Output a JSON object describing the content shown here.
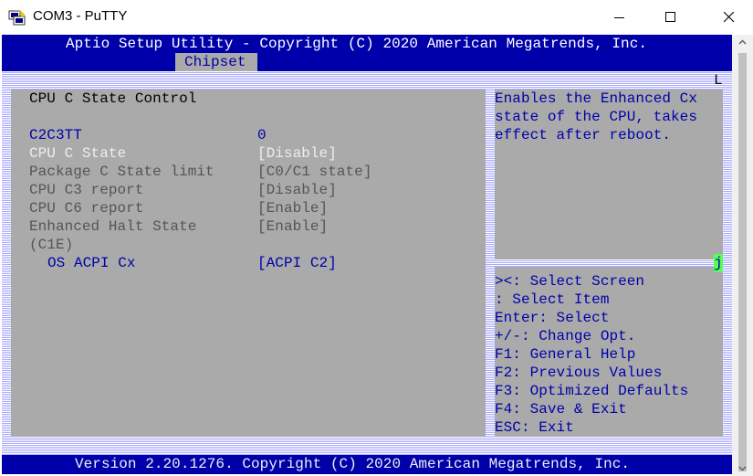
{
  "window": {
    "title": "COM3 - PuTTY",
    "icon": "putty-terminal-icon"
  },
  "bios": {
    "header": "Aptio Setup Utility - Copyright (C) 2020 American Megatrends, Inc.",
    "active_tab": "Chipset",
    "section_title": "CPU C State Control",
    "settings": [
      {
        "label": "C2C3TT",
        "value": "0"
      },
      {
        "label": "CPU C State",
        "value": "[Disable]"
      },
      {
        "label": "Package C State limit",
        "value": "[C0/C1 state]"
      },
      {
        "label": "CPU C3 report",
        "value": "[Disable]"
      },
      {
        "label": "CPU C6 report",
        "value": "[Enable]"
      },
      {
        "label": "Enhanced Halt State",
        "label2": "(C1E)",
        "value": "[Enable]"
      },
      {
        "label": "OS ACPI Cx",
        "value": "[ACPI C2]"
      }
    ],
    "help_lines": [
      "Enables the Enhanced Cx",
      "state of the CPU, takes",
      "effect after reboot."
    ],
    "keys": [
      "><: Select Screen",
      ": Select Item",
      "Enter: Select",
      "+/-: Change Opt.",
      "F1: General Help",
      "F2: Previous Values",
      "F3: Optimized Defaults",
      "F4: Save & Exit",
      "ESC: Exit"
    ],
    "footer": "Version 2.20.1276. Copyright (C) 2020 American Megatrends, Inc.",
    "corner_top_right": "L",
    "corner_mid_right": "j"
  },
  "colors": {
    "bios_blue": "#0000aa",
    "bios_grey": "#aaaaaa",
    "cursor_green": "#55ff55"
  }
}
